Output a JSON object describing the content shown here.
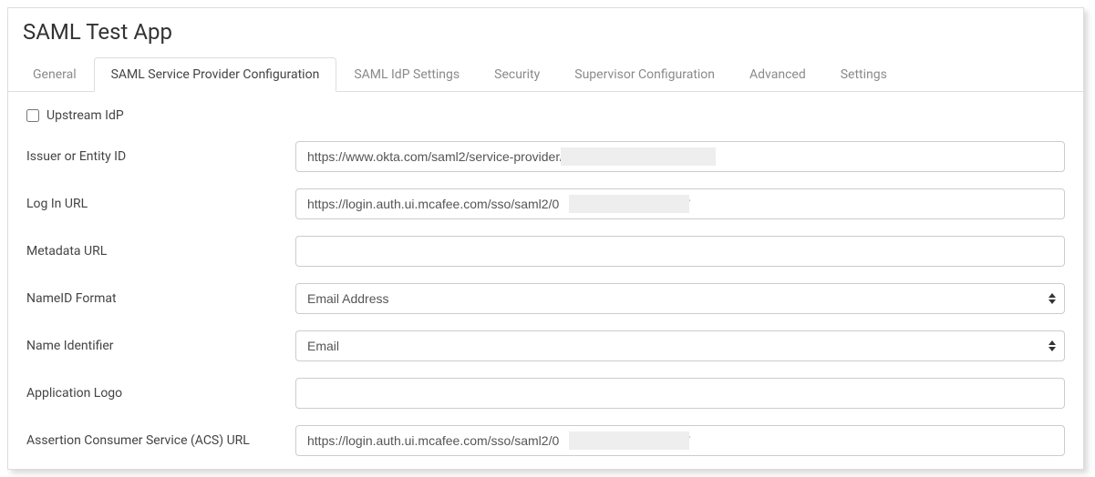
{
  "page_title": "SAML Test App",
  "tabs": [
    {
      "label": "General"
    },
    {
      "label": "SAML Service Provider Configuration"
    },
    {
      "label": "SAML IdP Settings"
    },
    {
      "label": "Security"
    },
    {
      "label": "Supervisor Configuration"
    },
    {
      "label": "Advanced"
    },
    {
      "label": "Settings"
    }
  ],
  "upstream_idp_label": "Upstream IdP",
  "fields": {
    "issuer": {
      "label": "Issuer or Entity ID",
      "value": "https://www.okta.com/saml2/service-provider/s                                     g"
    },
    "login_url": {
      "label": "Log In URL",
      "value": "https://login.auth.ui.mcafee.com/sso/saml2/0                                   7"
    },
    "metadata_url": {
      "label": "Metadata URL",
      "value": ""
    },
    "nameid_format": {
      "label": "NameID Format",
      "value": "Email Address"
    },
    "name_identifier": {
      "label": "Name Identifier",
      "value": "Email"
    },
    "app_logo": {
      "label": "Application Logo",
      "value": ""
    },
    "acs_url": {
      "label": "Assertion Consumer Service (ACS) URL",
      "value": "https://login.auth.ui.mcafee.com/sso/saml2/0                                   7"
    }
  }
}
